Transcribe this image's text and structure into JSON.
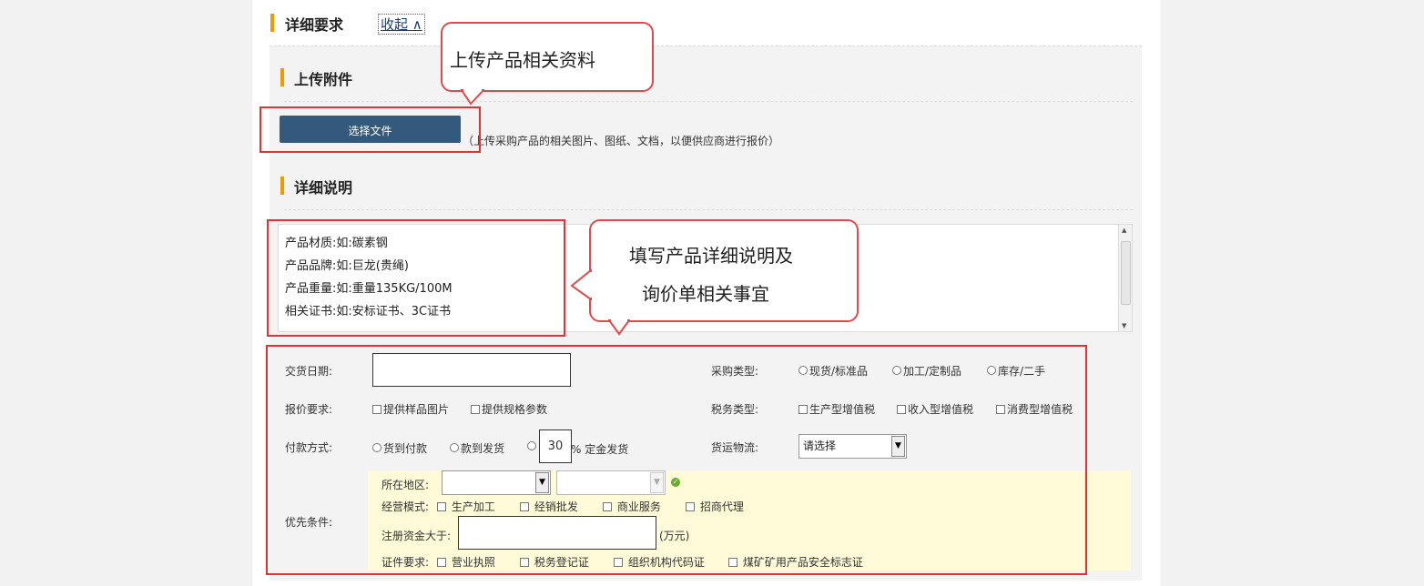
{
  "section": {
    "title": "详细要求",
    "collapse_label": "收起",
    "collapse_arrow": "∧"
  },
  "attachment": {
    "title": "上传附件",
    "button_label": "选择文件",
    "hint": "（上传采购产品的相关图片、图纸、文档，以便供应商进行报价）"
  },
  "description": {
    "title": "详细说明",
    "lines": [
      "产品材质:如:碳素钢",
      "产品品牌:如:巨龙(贵绳)",
      "产品重量:如:重量135KG/100M",
      "相关证书:如:安标证书、3C证书"
    ]
  },
  "callouts": {
    "upload": "上传产品相关资料",
    "fill_line1": "填写产品详细说明及",
    "fill_line2": "询价单相关事宜"
  },
  "form": {
    "delivery_date": {
      "label": "交货日期:",
      "value": ""
    },
    "purchase_type": {
      "label": "采购类型:",
      "options": [
        "现货/标准品",
        "加工/定制品",
        "库存/二手"
      ]
    },
    "quote_req": {
      "label": "报价要求:",
      "options": [
        "提供样品图片",
        "提供规格参数"
      ]
    },
    "tax_type": {
      "label": "税务类型:",
      "options": [
        "生产型增值税",
        "收入型增值税",
        "消费型增值税"
      ]
    },
    "payment": {
      "label": "付款方式:",
      "options": [
        "货到付款",
        "款到发货"
      ],
      "deposit_value": "30",
      "deposit_suffix": "% 定金发货"
    },
    "logistics": {
      "label": "货运物流:",
      "value": "请选择"
    },
    "priority": {
      "label": "优先条件:",
      "region_label": "所在地区:",
      "mode_label": "经营模式:",
      "modes": [
        "生产加工",
        "经销批发",
        "商业服务",
        "招商代理"
      ],
      "capital_label": "注册资金大于:",
      "capital_unit": "(万元)",
      "cert_label": "证件要求:",
      "certs": [
        "营业执照",
        "税务登记证",
        "组织机构代码证",
        "煤矿矿用产品安全标志证"
      ]
    }
  }
}
